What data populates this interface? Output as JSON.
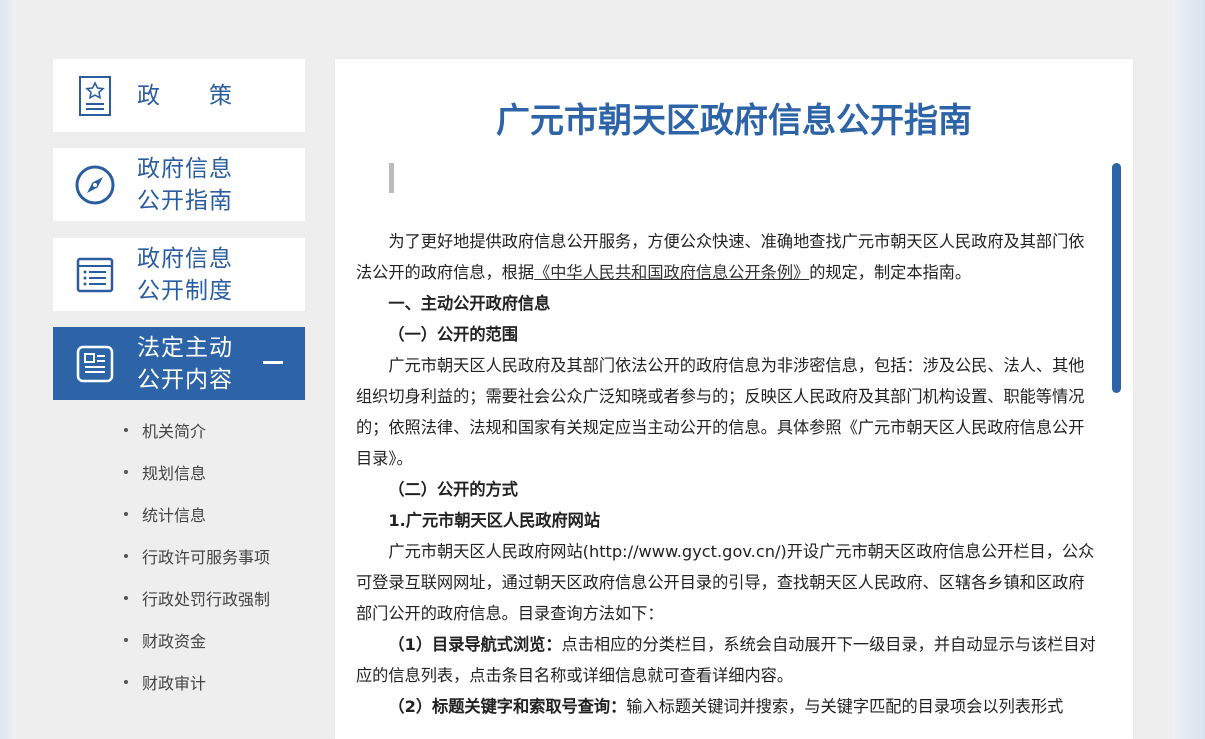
{
  "sidebar": {
    "items": [
      {
        "label": "政　　策",
        "icon": "policy-document-icon"
      },
      {
        "label": "政府信息\n公开指南",
        "icon": "compass-icon"
      },
      {
        "label": "政府信息\n公开制度",
        "icon": "list-document-icon"
      },
      {
        "label": "法定主动\n公开内容",
        "icon": "content-document-icon",
        "active": true
      }
    ],
    "subitems": [
      "机关简介",
      "规划信息",
      "统计信息",
      "行政许可服务事项",
      "行政处罚行政强制",
      "财政资金",
      "财政审计"
    ]
  },
  "main": {
    "title": "广元市朝天区政府信息公开指南",
    "p1_before": "为了更好地提供政府信息公开服务，方便公众快速、准确地查找广元市朝天区人民政府及其部门依法公开的政府信息，根据",
    "p1_link": "《中华人民共和国政府信息公开条例》",
    "p1_after": "的规定，制定本指南。",
    "h1": "一、主动公开政府信息",
    "h2": "（一）公开的范围",
    "p2": "广元市朝天区人民政府及其部门依法公开的政府信息为非涉密信息，包括：涉及公民、法人、其他组织切身利益的；需要社会公众广泛知晓或者参与的；反映区人民政府及其部门机构设置、职能等情况的；依照法律、法规和国家有关规定应当主动公开的信息。具体参照《广元市朝天区人民政府信息公开目录》。",
    "h3": "（二）公开的方式",
    "h4": "1.广元市朝天区人民政府网站",
    "p3": "广元市朝天区人民政府网站(http://www.gyct.gov.cn/)开设广元市朝天区政府信息公开栏目，公众可登录互联网网址，通过朝天区政府信息公开目录的引导，查找朝天区人民政府、区辖各乡镇和区政府部门公开的政府信息。目录查询方法如下：",
    "p4_bold": "（1）目录导航式浏览：",
    "p4": "点击相应的分类栏目，系统会自动展开下一级目录，并自动显示与该栏目对应的信息列表，点击条目名称或详细信息就可查看详细内容。",
    "p5_bold": "（2）标题关键字和索取号查询：",
    "p5": "输入标题关键词并搜索，与关键字匹配的目录项会以列表形式"
  }
}
